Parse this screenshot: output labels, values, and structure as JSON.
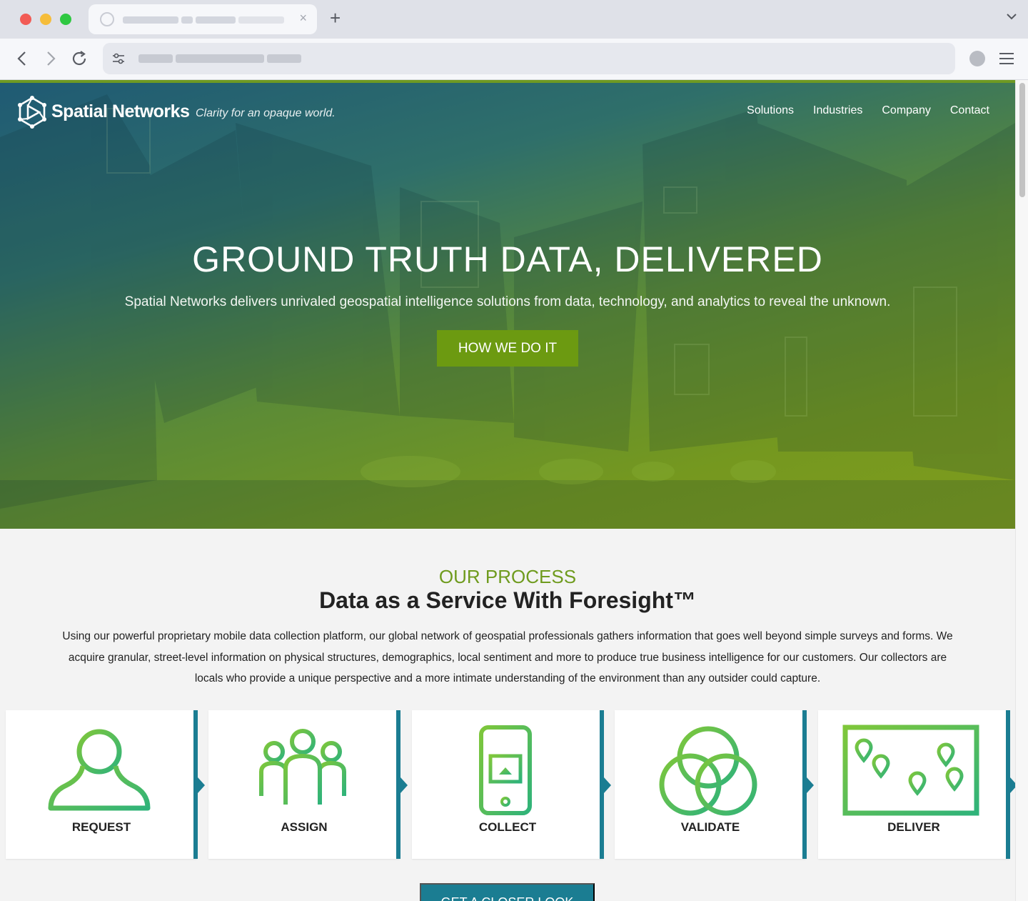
{
  "browser": {
    "tab_close": "×",
    "new_tab": "+"
  },
  "header": {
    "brand": "Spatial Networks",
    "tagline": "Clarity for an opaque world.",
    "nav": [
      "Solutions",
      "Industries",
      "Company",
      "Contact"
    ]
  },
  "hero": {
    "title": "GROUND TRUTH DATA, DELIVERED",
    "subtitle": "Spatial Networks delivers unrivaled geospatial intelligence solutions from data, technology, and analytics to reveal the unknown.",
    "button": "HOW WE DO IT"
  },
  "process": {
    "kicker": "OUR PROCESS",
    "title": "Data as a Service With Foresight™",
    "text": "Using our powerful proprietary mobile data collection platform, our global network of geospatial professionals gathers information that goes well beyond simple surveys and forms. We acquire granular, street-level information on physical structures, demographics, local sentiment and more to produce true business intelligence for our customers. Our collectors are locals who provide a unique perspective and a more intimate understanding of the environment than any outsider could capture.",
    "steps": [
      {
        "label": "REQUEST",
        "icon": "person-icon"
      },
      {
        "label": "ASSIGN",
        "icon": "team-icon"
      },
      {
        "label": "COLLECT",
        "icon": "phone-icon"
      },
      {
        "label": "VALIDATE",
        "icon": "venn-icon"
      },
      {
        "label": "DELIVER",
        "icon": "map-pins-icon"
      }
    ],
    "button": "GET A CLOSER LOOK"
  },
  "colors": {
    "accent_green": "#6c9a11",
    "accent_teal": "#1b7d92"
  }
}
